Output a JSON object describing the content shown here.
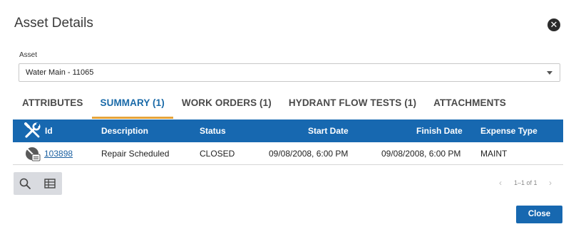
{
  "dialog": {
    "title": "Asset Details",
    "close_icon": "close-circle-icon"
  },
  "asset": {
    "label": "Asset",
    "value": "Water Main - 11065"
  },
  "tabs": [
    {
      "label": "ATTRIBUTES",
      "active": false
    },
    {
      "label": "SUMMARY (1)",
      "active": true
    },
    {
      "label": "WORK ORDERS (1)",
      "active": false
    },
    {
      "label": "HYDRANT FLOW TESTS (1)",
      "active": false
    },
    {
      "label": "ATTACHMENTS",
      "active": false
    }
  ],
  "grid": {
    "header_icon": "wrench-screwdriver-icon",
    "columns": [
      "Id",
      "Description",
      "Status",
      "Start Date",
      "Finish Date",
      "Expense Type"
    ],
    "rows": [
      {
        "icon": "work-order-icon",
        "id": "103898",
        "description": "Repair Scheduled",
        "status": "CLOSED",
        "start_date": "09/08/2008, 6:00 PM",
        "finish_date": "09/08/2008, 6:00 PM",
        "expense_type": "MAINT"
      }
    ]
  },
  "toolbar": {
    "search_icon": "search-icon",
    "table_icon": "table-icon"
  },
  "pager": {
    "text": "1–1 of 1"
  },
  "footer": {
    "close_label": "Close"
  },
  "colors": {
    "header_blue": "#1768b0",
    "active_tab_text": "#1a6aa8",
    "active_tab_underline": "#e6a43a"
  }
}
